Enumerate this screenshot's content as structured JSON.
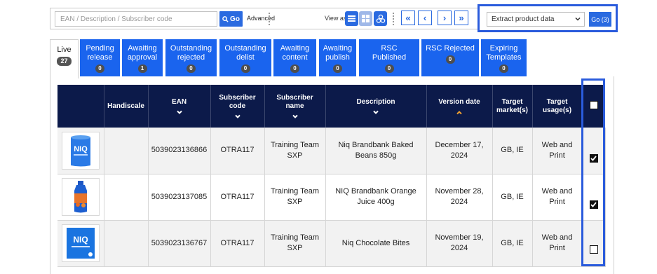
{
  "toolbar": {
    "search_placeholder": "EAN / Description / Subscriber code",
    "go_label": "Go",
    "advanced_label": "Advanced",
    "view_as_label": "View as",
    "pager": [
      "«",
      "‹",
      "›",
      "»"
    ],
    "extract_select_value": "Extract product data",
    "extract_go_label": "Go (3)"
  },
  "tabs": [
    {
      "label": "Live",
      "count": "27"
    },
    {
      "label": "Pending release",
      "count": "0"
    },
    {
      "label": "Awaiting approval",
      "count": "1"
    },
    {
      "label": "Outstanding rejected",
      "count": "0"
    },
    {
      "label": "Outstanding delist",
      "count": "0"
    },
    {
      "label": "Awaiting content",
      "count": "0"
    },
    {
      "label": "Awaiting publish",
      "count": "0"
    },
    {
      "label": "RSC Published",
      "count": "0"
    },
    {
      "label": "RSC Rejected",
      "count": "0"
    },
    {
      "label": "Expiring Templates",
      "count": "0"
    }
  ],
  "table": {
    "headers": [
      "",
      "Handiscale",
      "EAN",
      "Subscriber code",
      "Subscriber name",
      "Description",
      "Version date",
      "Target market(s)",
      "Target usage(s)"
    ],
    "rows": [
      {
        "image": "niq-baked-beans-image",
        "handiscale": "",
        "ean": "5039023136866",
        "subscriber_code": "OTRA117",
        "subscriber_name": "Training Team SXP",
        "description": "Niq Brandbank Baked Beans 850g",
        "version_date": "December 17, 2024",
        "target_markets": "GB, IE",
        "target_usages": "Web and Print",
        "checked": true
      },
      {
        "image": "niq-orange-juice-image",
        "handiscale": "",
        "ean": "5039023137085",
        "subscriber_code": "OTRA117",
        "subscriber_name": "Training Team SXP",
        "description": "NIQ Brandbank Orange Juice 400g",
        "version_date": "November 28, 2024",
        "target_markets": "GB, IE",
        "target_usages": "Web and Print",
        "checked": true
      },
      {
        "image": "niq-chocolate-bites-image",
        "handiscale": "",
        "ean": "5039023136767",
        "subscriber_code": "OTRA117",
        "subscriber_name": "Training Team SXP",
        "description": "Niq Chocolate Bites",
        "version_date": "November 19, 2024",
        "target_markets": "GB, IE",
        "target_usages": "Web and Print",
        "checked": false
      }
    ]
  },
  "colors": {
    "accent": "#1a64ee",
    "header_bg": "#0c1a4a",
    "highlight": "#2a5bdc",
    "sort_active": "#f0a030"
  }
}
